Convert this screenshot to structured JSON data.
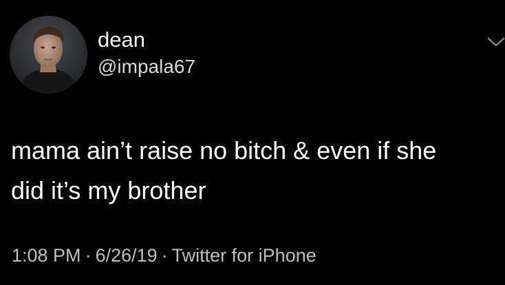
{
  "tweet": {
    "display_name": "dean",
    "handle": "@impala67",
    "text_lines": [
      "mama ain’t raise no bitch & even if she",
      "did it’s my brother"
    ],
    "time": "1:08 PM",
    "date": "6/26/19",
    "source": "Twitter for iPhone",
    "separator": "·",
    "avatar_icon": "profile-photo",
    "menu_icon": "chevron-down-icon"
  },
  "colors": {
    "background": "#000000",
    "primary_text": "#ffffff",
    "secondary_text": "#bfbfbf"
  }
}
